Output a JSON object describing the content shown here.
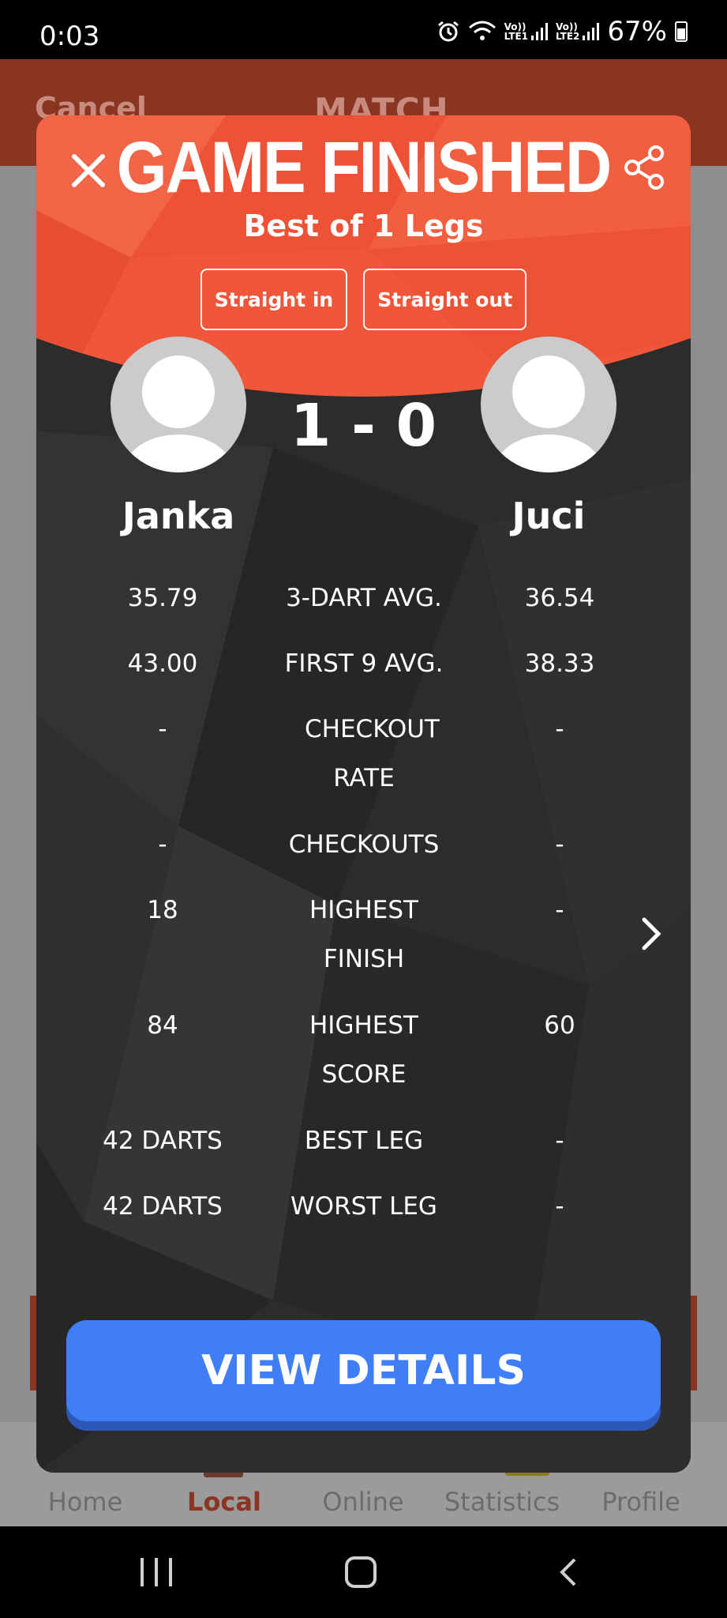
{
  "status_bar": {
    "time": "0:03",
    "battery": "67%",
    "sim1": [
      "Vo))",
      "LTE1"
    ],
    "sim2": [
      "Vo))",
      "LTE2"
    ],
    "icons": [
      "alarm-icon",
      "wifi-icon",
      "signal-icon",
      "battery-icon"
    ]
  },
  "background_app": {
    "header_cancel": "Cancel",
    "header_title": "MATCH",
    "tabs": [
      {
        "label": "Home",
        "active": false
      },
      {
        "label": "Local",
        "active": true
      },
      {
        "label": "Online",
        "active": false
      },
      {
        "label": "Statistics",
        "active": false
      },
      {
        "label": "Profile",
        "active": false
      }
    ]
  },
  "modal": {
    "title": "GAME FINISHED",
    "subtitle": "Best of 1 Legs",
    "chips": [
      "Straight in",
      "Straight out"
    ],
    "score": "1 - 0",
    "player_left": "Janka",
    "player_right": "Juci",
    "stats": [
      {
        "left": "35.79",
        "label": "3-DART AVG.",
        "right": "36.54"
      },
      {
        "left": "43.00",
        "label": "FIRST 9 AVG.",
        "right": "38.33"
      },
      {
        "left": "-",
        "label": "CHECKOUT RATE",
        "right": "-"
      },
      {
        "left": "-",
        "label": "CHECKOUTS",
        "right": "-"
      },
      {
        "left": "18",
        "label": "HIGHEST FINISH",
        "right": "-"
      },
      {
        "left": "84",
        "label": "HIGHEST SCORE",
        "right": "60"
      },
      {
        "left": "42 DARTS",
        "label": "BEST LEG",
        "right": "-"
      },
      {
        "left": "42 DARTS",
        "label": "WORST LEG",
        "right": "-"
      }
    ],
    "view_details": "VIEW DETAILS"
  },
  "colors": {
    "header_orange": "#f0573a",
    "modal_dark": "#2a2a2a",
    "button_blue": "#3f7ef7",
    "app_red": "#8a3422"
  }
}
